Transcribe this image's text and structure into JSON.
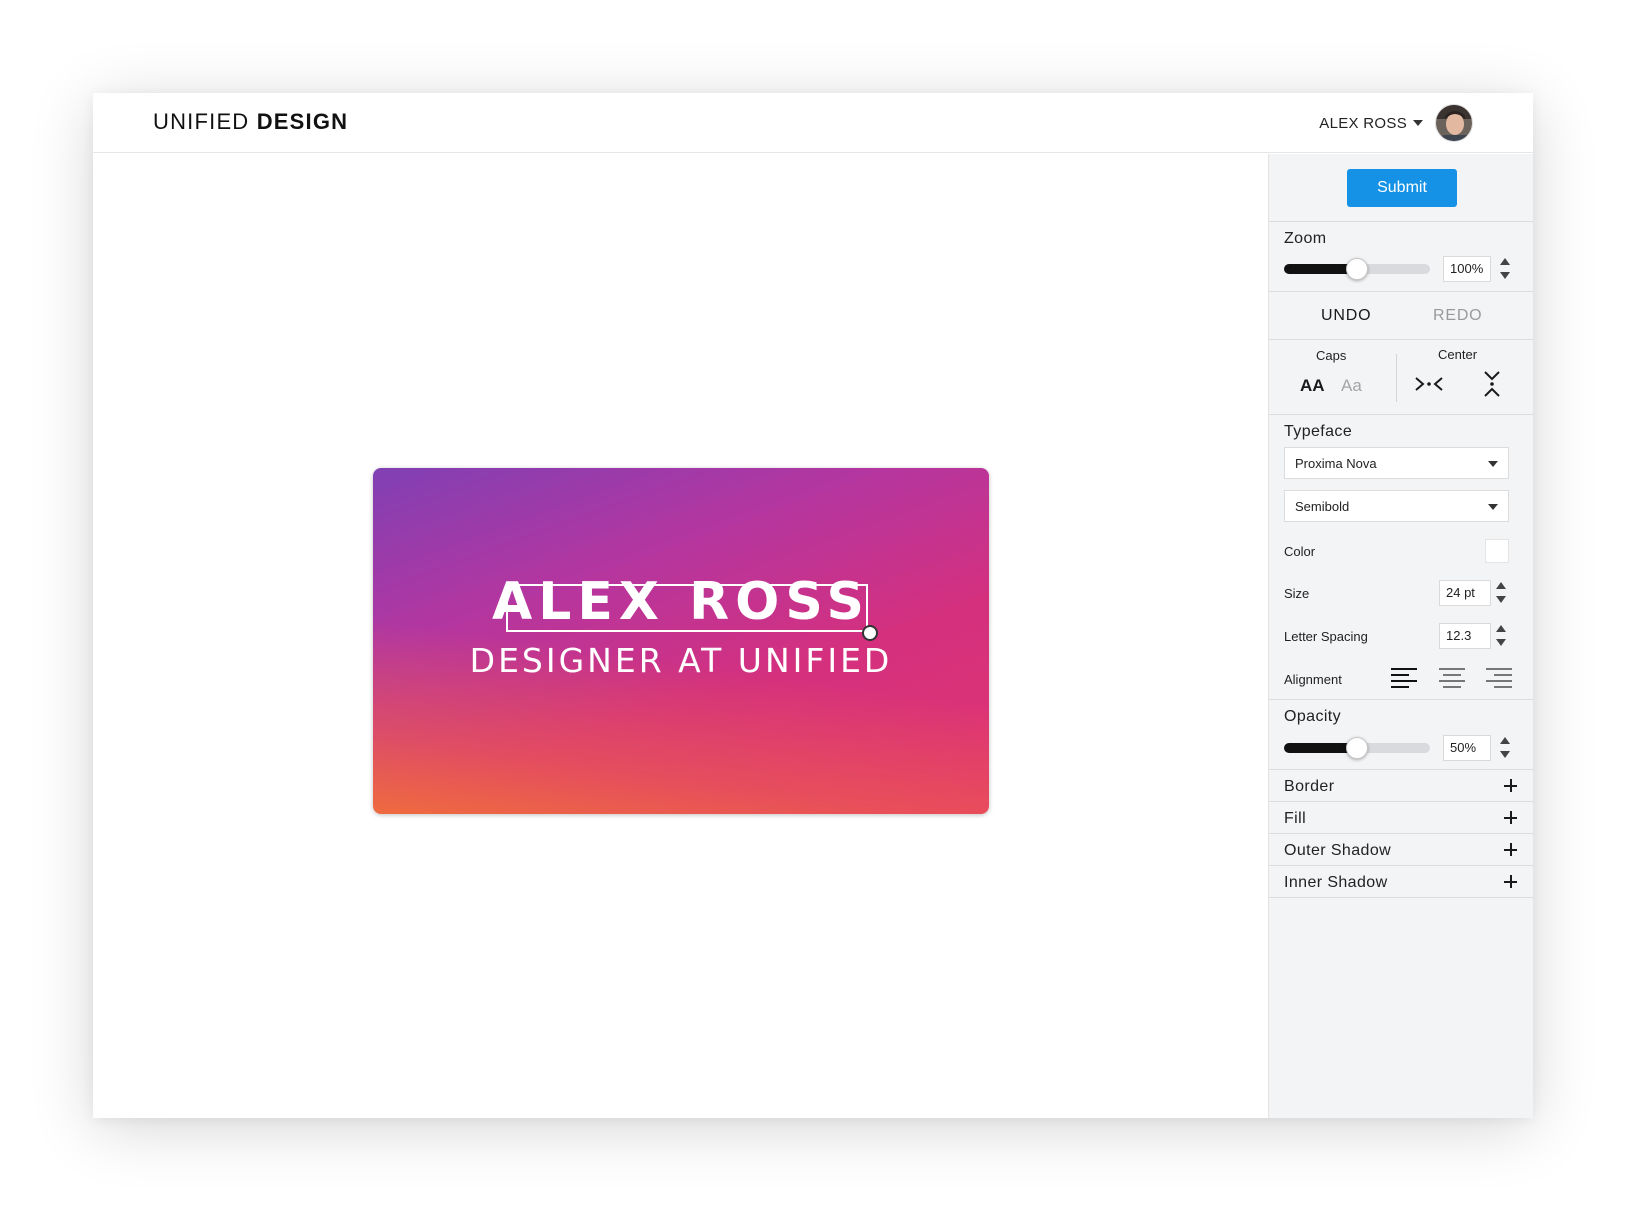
{
  "header": {
    "brand_light": "UNIFIED",
    "brand_bold": "DESIGN",
    "user_name": "ALEX ROSS"
  },
  "card": {
    "name": "ALEX ROSS",
    "subtitle": "DESIGNER AT UNIFIED",
    "gradient_colors": [
      "#8040b4",
      "#d4307e",
      "#e23570",
      "#f06e3c"
    ]
  },
  "panel": {
    "submit_label": "Submit",
    "zoom": {
      "label": "Zoom",
      "value": "100%",
      "level": 0.5
    },
    "history": {
      "undo": "UNDO",
      "redo": "REDO"
    },
    "caps": {
      "label": "Caps",
      "upper": "AA",
      "title": "Aa"
    },
    "center": {
      "label": "Center"
    },
    "typeface": {
      "label": "Typeface",
      "font": "Proxima Nova",
      "weight": "Semibold",
      "color_label": "Color",
      "color_value": "#ffffff",
      "size_label": "Size",
      "size_value": "24 pt",
      "spacing_label": "Letter Spacing",
      "spacing_value": "12.3",
      "alignment_label": "Alignment",
      "alignment_selected": "left"
    },
    "opacity": {
      "label": "Opacity",
      "value": "50%",
      "level": 0.5
    },
    "expanders": [
      "Border",
      "Fill",
      "Outer Shadow",
      "Inner Shadow"
    ]
  },
  "colors": {
    "accent": "#1592e6",
    "panel_bg": "#f3f4f6"
  }
}
